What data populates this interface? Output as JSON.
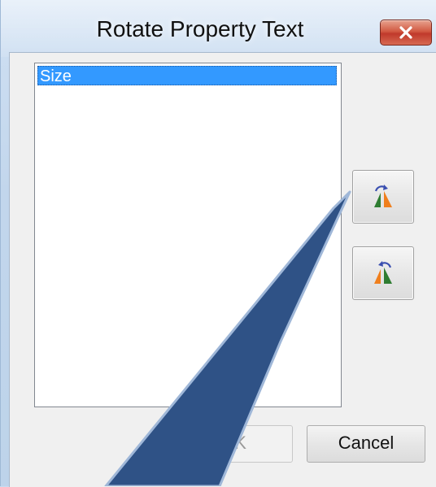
{
  "window": {
    "title": "Rotate Property Text",
    "close_icon": "close-icon"
  },
  "list": {
    "items": [
      {
        "label": "Size",
        "selected": true
      }
    ]
  },
  "rotate_buttons": [
    {
      "icon": "rotate-text-clockwise-icon"
    },
    {
      "icon": "rotate-text-counterclockwise-icon"
    }
  ],
  "buttons": {
    "ok_label": "OK",
    "cancel_label": "Cancel"
  },
  "colors": {
    "selection": "#3399ff",
    "callout_fill": "#2f5286",
    "icon_green": "#2f7d32",
    "icon_orange": "#f07f1d",
    "icon_blue": "#3a4fb0"
  }
}
